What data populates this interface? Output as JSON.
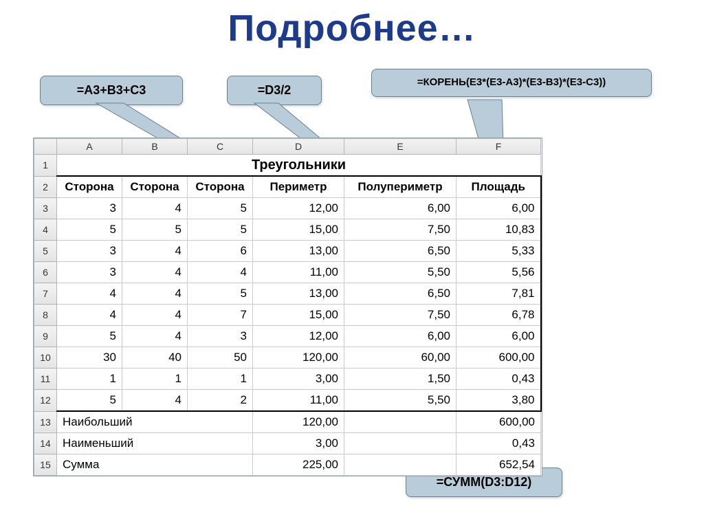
{
  "title": "Подробнее…",
  "callouts": {
    "c1": "=A3+B3+C3",
    "c2": "=D3/2",
    "c3": "=КОРЕНЬ(E3*(E3-A3)*(E3-B3)*(E3-C3))",
    "c4": "=СУММ(D3:D12)"
  },
  "sheet": {
    "columns": [
      "A",
      "B",
      "C",
      "D",
      "E",
      "F"
    ],
    "mergedTitle": "Треугольники",
    "headers": [
      "Сторона",
      "Сторона",
      "Сторона",
      "Периметр",
      "Полупериметр",
      "Площадь"
    ],
    "rows": [
      {
        "n": 3,
        "a": "3",
        "b": "4",
        "c": "5",
        "d": "12,00",
        "e": "6,00",
        "f": "6,00"
      },
      {
        "n": 4,
        "a": "5",
        "b": "5",
        "c": "5",
        "d": "15,00",
        "e": "7,50",
        "f": "10,83"
      },
      {
        "n": 5,
        "a": "3",
        "b": "4",
        "c": "6",
        "d": "13,00",
        "e": "6,50",
        "f": "5,33"
      },
      {
        "n": 6,
        "a": "3",
        "b": "4",
        "c": "4",
        "d": "11,00",
        "e": "5,50",
        "f": "5,56"
      },
      {
        "n": 7,
        "a": "4",
        "b": "4",
        "c": "5",
        "d": "13,00",
        "e": "6,50",
        "f": "7,81"
      },
      {
        "n": 8,
        "a": "4",
        "b": "4",
        "c": "7",
        "d": "15,00",
        "e": "7,50",
        "f": "6,78"
      },
      {
        "n": 9,
        "a": "5",
        "b": "4",
        "c": "3",
        "d": "12,00",
        "e": "6,00",
        "f": "6,00"
      },
      {
        "n": 10,
        "a": "30",
        "b": "40",
        "c": "50",
        "d": "120,00",
        "e": "60,00",
        "f": "600,00"
      },
      {
        "n": 11,
        "a": "1",
        "b": "1",
        "c": "1",
        "d": "3,00",
        "e": "1,50",
        "f": "0,43"
      },
      {
        "n": 12,
        "a": "5",
        "b": "4",
        "c": "2",
        "d": "11,00",
        "e": "5,50",
        "f": "3,80"
      }
    ],
    "summary": [
      {
        "n": 13,
        "label": "Наибольший",
        "d": "120,00",
        "f": "600,00"
      },
      {
        "n": 14,
        "label": "Наименьший",
        "d": "3,00",
        "f": "0,43"
      },
      {
        "n": 15,
        "label": "Сумма",
        "d": "225,00",
        "f": "652,54"
      }
    ]
  }
}
